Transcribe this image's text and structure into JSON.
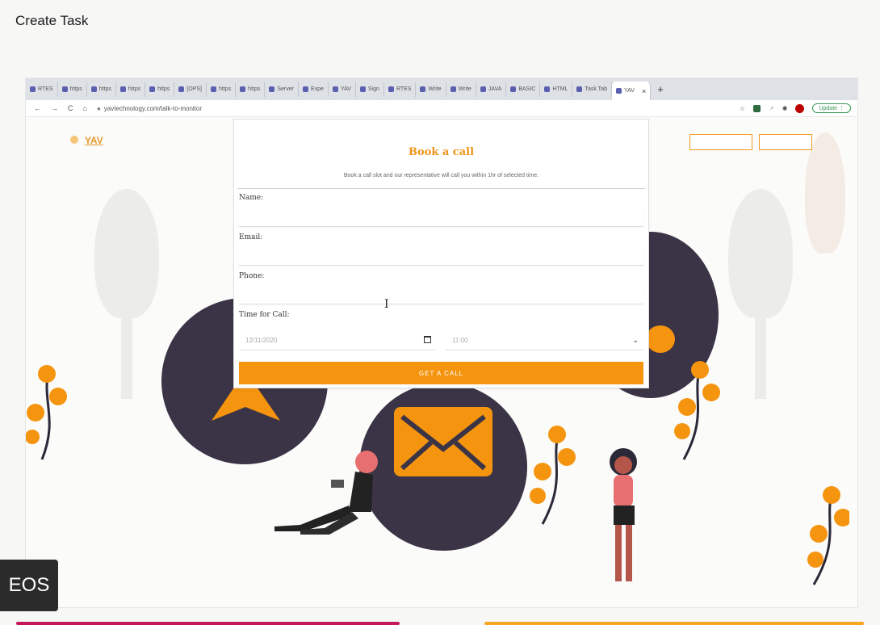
{
  "page": {
    "title": "Create Task"
  },
  "browser": {
    "tabs": [
      {
        "label": "RTES"
      },
      {
        "label": "https"
      },
      {
        "label": "https"
      },
      {
        "label": "https"
      },
      {
        "label": "https"
      },
      {
        "label": "[OPS]"
      },
      {
        "label": "https"
      },
      {
        "label": "https"
      },
      {
        "label": "Server"
      },
      {
        "label": "Expe"
      },
      {
        "label": "YAV"
      },
      {
        "label": "Sign"
      },
      {
        "label": "RTES"
      },
      {
        "label": "Write"
      },
      {
        "label": "Write"
      },
      {
        "label": "JAVA"
      },
      {
        "label": "BASIC"
      },
      {
        "label": "HTML"
      },
      {
        "label": "Task Tab"
      },
      {
        "label": "YAV"
      }
    ],
    "active_tab_close": "×",
    "new_tab": "+",
    "url": "yavtechnology.com/talk-to-monitor",
    "update_label": "Update"
  },
  "site": {
    "logo": "YAV"
  },
  "modal": {
    "title": "Book a call",
    "subtitle": "Book a call slot and our representative will call you within 1hr of selected time.",
    "name_label": "Name:",
    "email_label": "Email:",
    "phone_label": "Phone:",
    "time_label": "Time for Call:",
    "date_value": "12/11/2020",
    "time_value": "11:00",
    "submit_label": "GET A CALL"
  },
  "badge": {
    "label": "EOS"
  },
  "colors": {
    "accent": "#f5940f",
    "dark_circle": "#3a3446",
    "update_green": "#3a9a55"
  }
}
